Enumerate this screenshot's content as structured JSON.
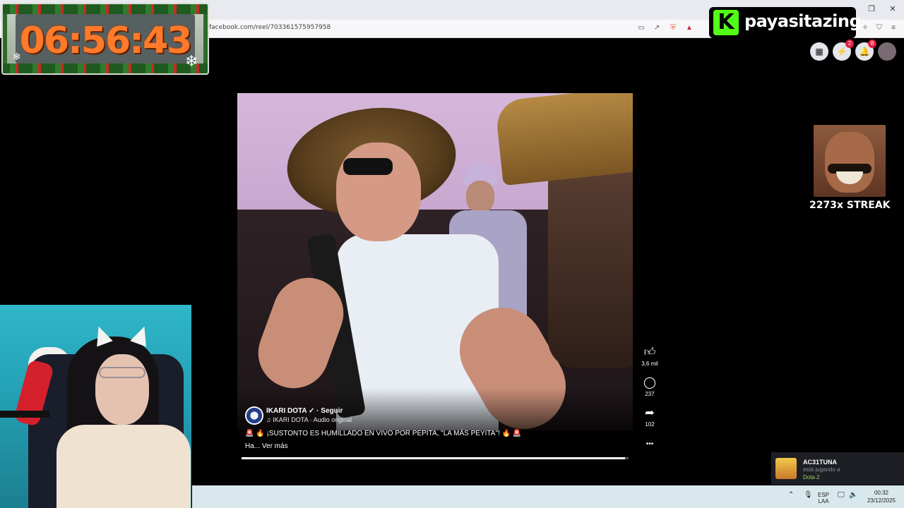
{
  "browser": {
    "url": "facebook.com/reel/703361575957958",
    "window_controls": [
      "–",
      "❐",
      "✕"
    ]
  },
  "timer": {
    "time": "06:56:43"
  },
  "kick": {
    "logo_letter": "K",
    "username": "payasitazing"
  },
  "fb_top": {
    "messenger_badge": "2",
    "notifications_badge": "8"
  },
  "reel": {
    "author": "IKARI DOTA",
    "verified_icon": "✓",
    "follow": "Seguir",
    "audio": "♫ IKARI DOTA · Audio original",
    "caption_line1": "🚨 🔥 ¡SUSTONTO ES HUMILLADO EN VIVO POR PEPITA, \"LA MÁS PEYITA\"! 🔥 🚨",
    "caption_line2": "Ha... Ver más",
    "progress": 0.99
  },
  "actions": {
    "likes": "3,6 mil",
    "comments": "237",
    "shares": "102",
    "more": "•••"
  },
  "streak": {
    "label": "2273x STREAK"
  },
  "toast": {
    "name": "AC31TUNA",
    "status": "está jugando a",
    "game": "Dota 2"
  },
  "taskbar": {
    "lang_top": "ESP",
    "lang_bottom": "LAA",
    "time": "00:32",
    "date": "23/12/2025"
  },
  "colors": {
    "timer_digits": "#ff7a2a",
    "kick_green": "#53fc18",
    "badge_red": "#e41e3f"
  }
}
